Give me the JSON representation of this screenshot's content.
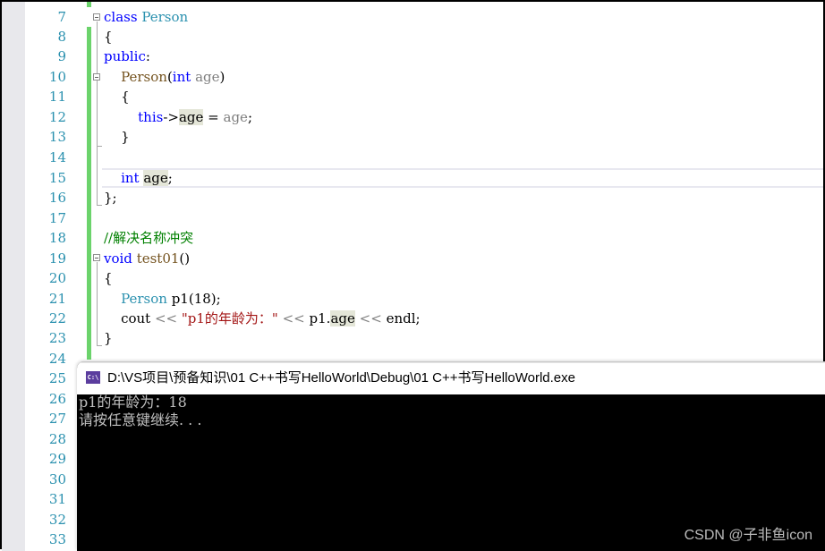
{
  "editor": {
    "line_numbers": [
      "7",
      "8",
      "9",
      "10",
      "11",
      "12",
      "13",
      "14",
      "15",
      "16",
      "17",
      "18",
      "19",
      "20",
      "21",
      "22",
      "23",
      "24",
      "25",
      "26",
      "27",
      "28",
      "29",
      "30",
      "31",
      "32",
      "33"
    ],
    "code": {
      "l7": {
        "kw": "class",
        "name": "Person"
      },
      "l8": "{",
      "l9": {
        "kw": "public",
        "colon": ":"
      },
      "l10": {
        "fn": "Person",
        "open": "(",
        "kw": "int",
        "param": "age",
        "close": ")"
      },
      "l11": "{",
      "l12": {
        "this": "this",
        "arrow": "->",
        "member": "age",
        "eq": " = ",
        "param": "age",
        "semi": ";"
      },
      "l13": "}",
      "l15": {
        "kw": "int",
        "member": "age",
        "semi": ";"
      },
      "l16": "};",
      "l18": {
        "comment": "//解决名称冲突"
      },
      "l19": {
        "kw": "void",
        "fn": "test01",
        "parens": "()"
      },
      "l20": "{",
      "l21": {
        "type": "Person",
        "rest": " p1(18);"
      },
      "l22": {
        "cout": "cout",
        "op1": " << ",
        "str": "\"p1的年龄为：\"",
        "op2": " << ",
        "obj": "p1.",
        "member": "age",
        "op3": " << ",
        "endl": "endl",
        "semi": ";"
      },
      "l23": "}"
    }
  },
  "console": {
    "icon": "C:\\",
    "title": "D:\\VS项目\\预备知识\\01 C++书写HelloWorld\\Debug\\01 C++书写HelloWorld.exe",
    "output": [
      "p1的年龄为：18",
      "请按任意键继续. . ."
    ]
  },
  "watermark": "CSDN @子非鱼icon"
}
